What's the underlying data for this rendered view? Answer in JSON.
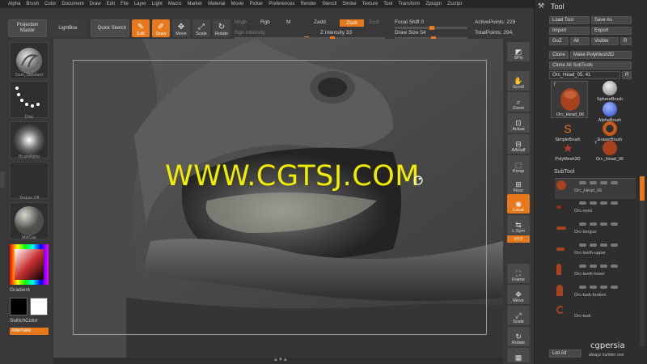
{
  "menu": [
    "Alpha",
    "Brush",
    "Color",
    "Document",
    "Draw",
    "Edit",
    "File",
    "Layer",
    "Light",
    "Macro",
    "Marker",
    "Material",
    "Movie",
    "Picker",
    "Preferences",
    "Render",
    "Stencil",
    "Stroke",
    "Texture",
    "Tool",
    "Transform",
    "Zplugin",
    "Zscript"
  ],
  "shelf": {
    "projection_master": "Projection Master",
    "lightbox": "LightBox",
    "quick_sketch": "Quick Sketch",
    "edit": "Edit",
    "draw": "Draw",
    "move": "Move",
    "scale": "Scale",
    "rotate": "Rotate",
    "mrgb": "Mrgb",
    "rgb": "Rgb",
    "m": "M",
    "rgb_intensity": "Rgb Intensity",
    "zadd": "Zadd",
    "zsub": "Zsub",
    "zcut": "Zcut",
    "z_intensity": "Z Intensity 33",
    "focal_shift": "Focal Shift 0",
    "draw_size": "Draw Size 54",
    "active_points": "ActivePoints: 229",
    "total_points": "TotalPoints: 294,"
  },
  "left": {
    "brush_label": "Dam_Standard",
    "stroke_label": "Dots",
    "alpha_label": "BrushAlpha",
    "texture_label": "Texture Off",
    "material_label": "MatCap",
    "gradient": "Gradient",
    "switchcolor": "SwitchColor",
    "alternate": "Alternate"
  },
  "canvas": {
    "watermark": "WWW.CGTSJ.COM"
  },
  "right": [
    "SPix",
    "Scroll",
    "Zoom",
    "Actual",
    "AAHalf",
    "Persp",
    "Floor",
    "Local",
    "L.Sym",
    "XYZ",
    "Frame",
    "Move",
    "Scale",
    "Rotate"
  ],
  "tool": {
    "title": "Tool",
    "load_tool": "Load Tool",
    "save_as": "Save As",
    "import": "Import",
    "export": "Export",
    "goz": "GoZ",
    "all": "All",
    "visible": "Visible",
    "r": "R",
    "clone": "Clone",
    "make_polymesh": "Make PolyMesh3D",
    "clone_all": "Clone All SubTools",
    "current": "Orc_Head_05. 41",
    "current_r": "R",
    "brushes": [
      {
        "label": "Orc_Head_06",
        "count": "7"
      },
      {
        "label": "SphereBrush"
      },
      {
        "label": "AlphaBrush"
      },
      {
        "label": "SimpleBrush"
      },
      {
        "label": "EraserBrush"
      },
      {
        "label": "PolyMesh3D"
      },
      {
        "label": "Orc_Head_06",
        "count": "7"
      }
    ],
    "subtool_title": "SubTool",
    "subtools": [
      "Orc_Head_06",
      "Orc-eyes",
      "Orc-tongue",
      "Orc-teeth-upper",
      "Orc-teeth-lower",
      "Orc-tusk-broken",
      "Orc-tusk"
    ],
    "list_all": "List All"
  },
  "logo": {
    "name": "cgpersia",
    "tagline": "always number one"
  },
  "colors": {
    "accent": "#e7781b",
    "watermark": "#f1ec00"
  }
}
